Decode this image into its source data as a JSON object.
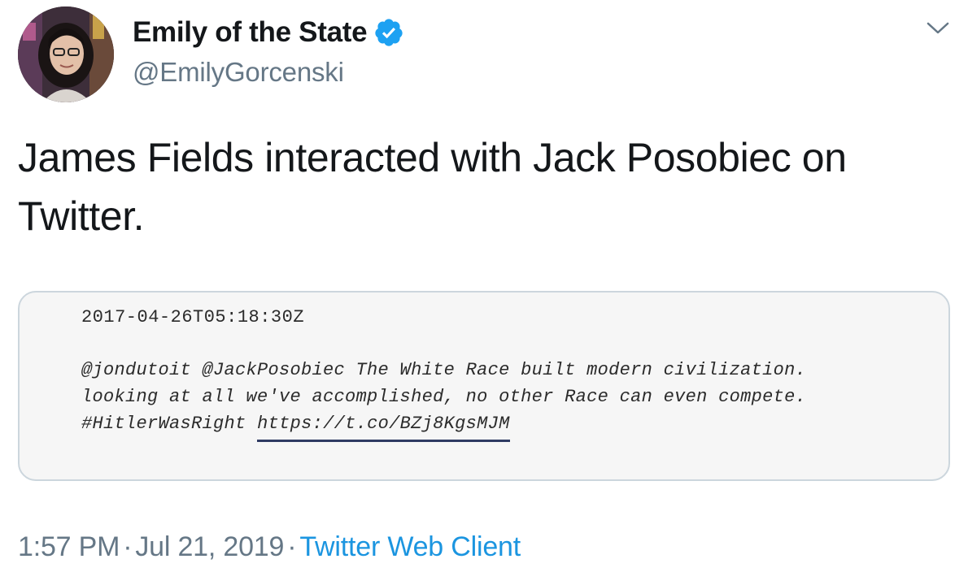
{
  "header": {
    "display_name": "Emily of the State",
    "handle": "@EmilyGorcenski",
    "verified_icon": "verified-badge-icon",
    "menu_icon": "chevron-down-icon"
  },
  "tweet": {
    "text": "James Fields interacted with Jack Posobiec on Twitter."
  },
  "media": {
    "timestamp": "2017-04-26T05:18:30Z",
    "line1": "@jondutoit @JackPosobiec The White Race built modern civilization.",
    "line2": "looking at all we've accomplished, no other Race can even compete.",
    "hashtag": "#HitlerWasRight",
    "link": "https://t.co/BZj8KgsMJM"
  },
  "meta": {
    "time": "1:57 PM",
    "separator": "·",
    "date": "Jul 21, 2019",
    "source": "Twitter Web Client"
  },
  "colors": {
    "verified_blue": "#1da1f2",
    "link_blue": "#1b95e0",
    "muted_gray": "#657786",
    "border_gray": "#ccd6dd"
  }
}
